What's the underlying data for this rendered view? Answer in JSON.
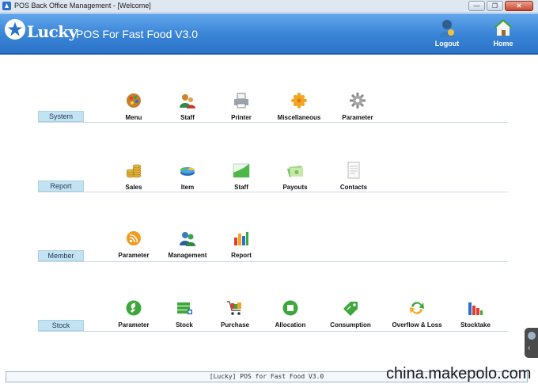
{
  "window": {
    "title": "POS Back Office Management - [Welcome]"
  },
  "header": {
    "brand": "Lucky",
    "subtitle": "POS For Fast Food V3.0",
    "logout_label": "Logout",
    "home_label": "Home"
  },
  "sections": {
    "system": {
      "label": "System",
      "items": [
        "Menu",
        "Staff",
        "Printer",
        "Miscellaneous",
        "Parameter"
      ]
    },
    "report": {
      "label": "Report",
      "items": [
        "Sales",
        "Item",
        "Staff",
        "Payouts",
        "Contacts"
      ]
    },
    "member": {
      "label": "Member",
      "items": [
        "Parameter",
        "Management",
        "Report"
      ]
    },
    "stock": {
      "label": "Stock",
      "items": [
        "Parameter",
        "Stock",
        "Purchase",
        "Allocation",
        "Consumption",
        "Overflow & Loss",
        "Stocktake"
      ]
    }
  },
  "statusbar": {
    "text": "[Lucky] POS for Fast Food V3.0"
  },
  "watermark": "china.makepolo.com",
  "colors": {
    "header": "#3c86d8",
    "section_tab": "#c4e3f2",
    "accent_green": "#3da83a"
  }
}
